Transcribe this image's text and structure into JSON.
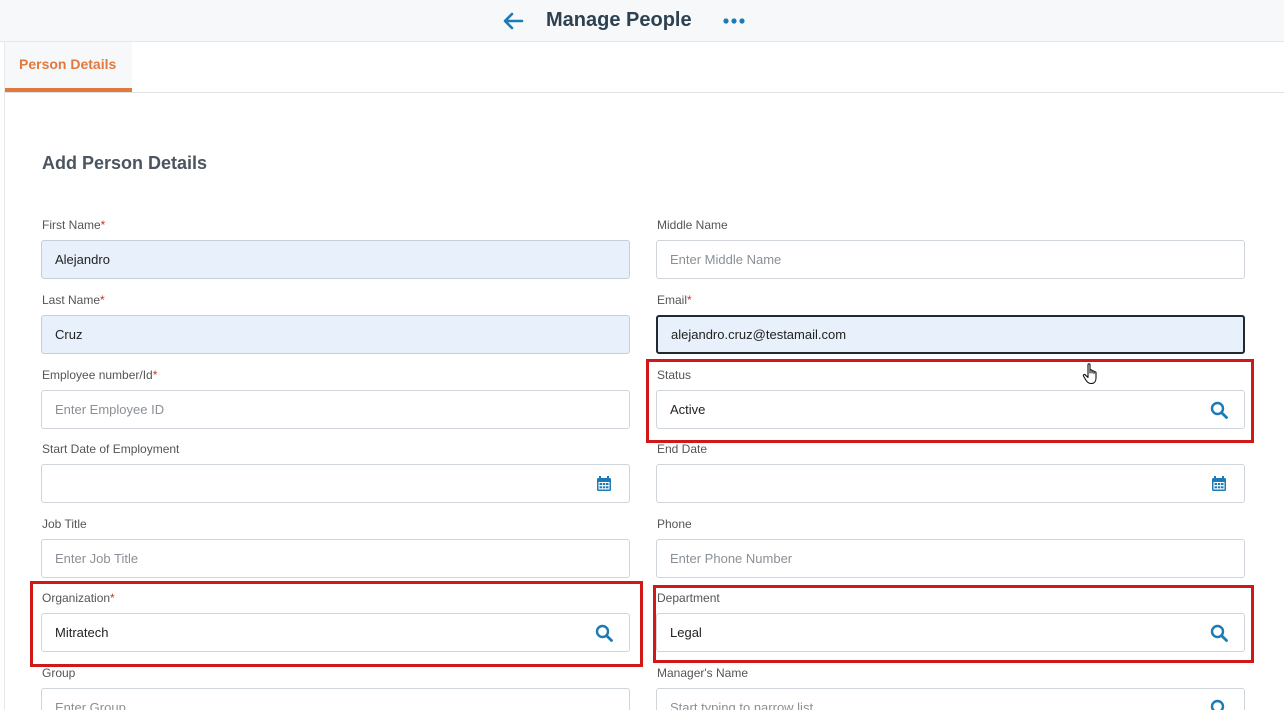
{
  "header": {
    "title": "Manage People",
    "back_icon": "arrow-left-icon",
    "more_icon": "more-horizontal-icon"
  },
  "tabs": [
    {
      "label": "Person Details",
      "active": true
    }
  ],
  "form": {
    "section_title": "Add Person Details",
    "first_name": {
      "label": "First Name",
      "required": "*",
      "value": "Alejandro"
    },
    "middle_name": {
      "label": "Middle Name",
      "placeholder": "Enter Middle Name"
    },
    "last_name": {
      "label": "Last Name",
      "required": "*",
      "value": "Cruz"
    },
    "email": {
      "label": "Email",
      "required": "*",
      "value": "alejandro.cruz@testamail.com"
    },
    "employee_id": {
      "label": "Employee number/Id",
      "required": "*",
      "placeholder": "Enter Employee ID"
    },
    "status": {
      "label": "Status",
      "value": "Active"
    },
    "start_date": {
      "label": "Start Date of Employment"
    },
    "end_date": {
      "label": "End Date"
    },
    "job_title": {
      "label": "Job Title",
      "placeholder": "Enter Job Title"
    },
    "phone": {
      "label": "Phone",
      "placeholder": "Enter Phone Number"
    },
    "organization": {
      "label": "Organization",
      "required": "*",
      "value": "Mitratech"
    },
    "department": {
      "label": "Department",
      "value": "Legal"
    },
    "group": {
      "label": "Group",
      "placeholder": "Enter Group"
    },
    "manager": {
      "label": "Manager's Name",
      "placeholder": "Start typing to narrow list"
    }
  },
  "colors": {
    "accent": "#e07a3c",
    "icon": "#1c7ab5",
    "highlight": "#d01818",
    "filled_bg": "#e8f0fb"
  }
}
